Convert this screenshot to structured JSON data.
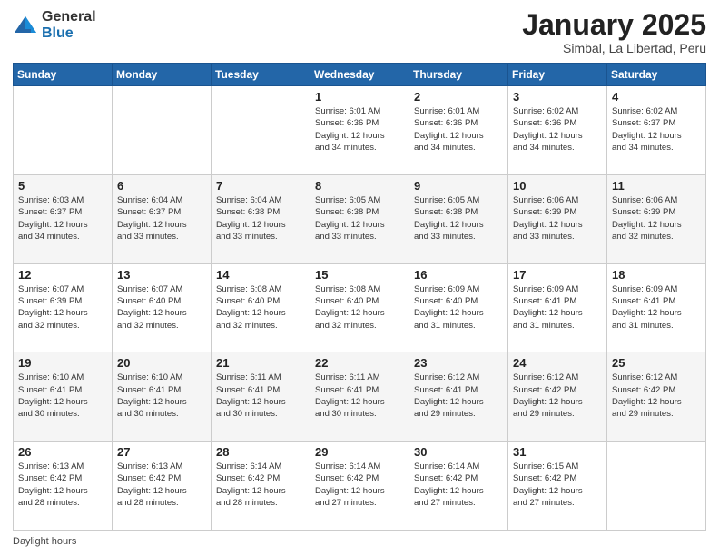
{
  "logo": {
    "general": "General",
    "blue": "Blue"
  },
  "title": "January 2025",
  "subtitle": "Simbal, La Libertad, Peru",
  "days_of_week": [
    "Sunday",
    "Monday",
    "Tuesday",
    "Wednesday",
    "Thursday",
    "Friday",
    "Saturday"
  ],
  "weeks": [
    [
      {
        "num": "",
        "info": ""
      },
      {
        "num": "",
        "info": ""
      },
      {
        "num": "",
        "info": ""
      },
      {
        "num": "1",
        "info": "Sunrise: 6:01 AM\nSunset: 6:36 PM\nDaylight: 12 hours\nand 34 minutes."
      },
      {
        "num": "2",
        "info": "Sunrise: 6:01 AM\nSunset: 6:36 PM\nDaylight: 12 hours\nand 34 minutes."
      },
      {
        "num": "3",
        "info": "Sunrise: 6:02 AM\nSunset: 6:36 PM\nDaylight: 12 hours\nand 34 minutes."
      },
      {
        "num": "4",
        "info": "Sunrise: 6:02 AM\nSunset: 6:37 PM\nDaylight: 12 hours\nand 34 minutes."
      }
    ],
    [
      {
        "num": "5",
        "info": "Sunrise: 6:03 AM\nSunset: 6:37 PM\nDaylight: 12 hours\nand 34 minutes."
      },
      {
        "num": "6",
        "info": "Sunrise: 6:04 AM\nSunset: 6:37 PM\nDaylight: 12 hours\nand 33 minutes."
      },
      {
        "num": "7",
        "info": "Sunrise: 6:04 AM\nSunset: 6:38 PM\nDaylight: 12 hours\nand 33 minutes."
      },
      {
        "num": "8",
        "info": "Sunrise: 6:05 AM\nSunset: 6:38 PM\nDaylight: 12 hours\nand 33 minutes."
      },
      {
        "num": "9",
        "info": "Sunrise: 6:05 AM\nSunset: 6:38 PM\nDaylight: 12 hours\nand 33 minutes."
      },
      {
        "num": "10",
        "info": "Sunrise: 6:06 AM\nSunset: 6:39 PM\nDaylight: 12 hours\nand 33 minutes."
      },
      {
        "num": "11",
        "info": "Sunrise: 6:06 AM\nSunset: 6:39 PM\nDaylight: 12 hours\nand 32 minutes."
      }
    ],
    [
      {
        "num": "12",
        "info": "Sunrise: 6:07 AM\nSunset: 6:39 PM\nDaylight: 12 hours\nand 32 minutes."
      },
      {
        "num": "13",
        "info": "Sunrise: 6:07 AM\nSunset: 6:40 PM\nDaylight: 12 hours\nand 32 minutes."
      },
      {
        "num": "14",
        "info": "Sunrise: 6:08 AM\nSunset: 6:40 PM\nDaylight: 12 hours\nand 32 minutes."
      },
      {
        "num": "15",
        "info": "Sunrise: 6:08 AM\nSunset: 6:40 PM\nDaylight: 12 hours\nand 32 minutes."
      },
      {
        "num": "16",
        "info": "Sunrise: 6:09 AM\nSunset: 6:40 PM\nDaylight: 12 hours\nand 31 minutes."
      },
      {
        "num": "17",
        "info": "Sunrise: 6:09 AM\nSunset: 6:41 PM\nDaylight: 12 hours\nand 31 minutes."
      },
      {
        "num": "18",
        "info": "Sunrise: 6:09 AM\nSunset: 6:41 PM\nDaylight: 12 hours\nand 31 minutes."
      }
    ],
    [
      {
        "num": "19",
        "info": "Sunrise: 6:10 AM\nSunset: 6:41 PM\nDaylight: 12 hours\nand 30 minutes."
      },
      {
        "num": "20",
        "info": "Sunrise: 6:10 AM\nSunset: 6:41 PM\nDaylight: 12 hours\nand 30 minutes."
      },
      {
        "num": "21",
        "info": "Sunrise: 6:11 AM\nSunset: 6:41 PM\nDaylight: 12 hours\nand 30 minutes."
      },
      {
        "num": "22",
        "info": "Sunrise: 6:11 AM\nSunset: 6:41 PM\nDaylight: 12 hours\nand 30 minutes."
      },
      {
        "num": "23",
        "info": "Sunrise: 6:12 AM\nSunset: 6:41 PM\nDaylight: 12 hours\nand 29 minutes."
      },
      {
        "num": "24",
        "info": "Sunrise: 6:12 AM\nSunset: 6:42 PM\nDaylight: 12 hours\nand 29 minutes."
      },
      {
        "num": "25",
        "info": "Sunrise: 6:12 AM\nSunset: 6:42 PM\nDaylight: 12 hours\nand 29 minutes."
      }
    ],
    [
      {
        "num": "26",
        "info": "Sunrise: 6:13 AM\nSunset: 6:42 PM\nDaylight: 12 hours\nand 28 minutes."
      },
      {
        "num": "27",
        "info": "Sunrise: 6:13 AM\nSunset: 6:42 PM\nDaylight: 12 hours\nand 28 minutes."
      },
      {
        "num": "28",
        "info": "Sunrise: 6:14 AM\nSunset: 6:42 PM\nDaylight: 12 hours\nand 28 minutes."
      },
      {
        "num": "29",
        "info": "Sunrise: 6:14 AM\nSunset: 6:42 PM\nDaylight: 12 hours\nand 27 minutes."
      },
      {
        "num": "30",
        "info": "Sunrise: 6:14 AM\nSunset: 6:42 PM\nDaylight: 12 hours\nand 27 minutes."
      },
      {
        "num": "31",
        "info": "Sunrise: 6:15 AM\nSunset: 6:42 PM\nDaylight: 12 hours\nand 27 minutes."
      },
      {
        "num": "",
        "info": ""
      }
    ]
  ],
  "footer_label": "Daylight hours"
}
